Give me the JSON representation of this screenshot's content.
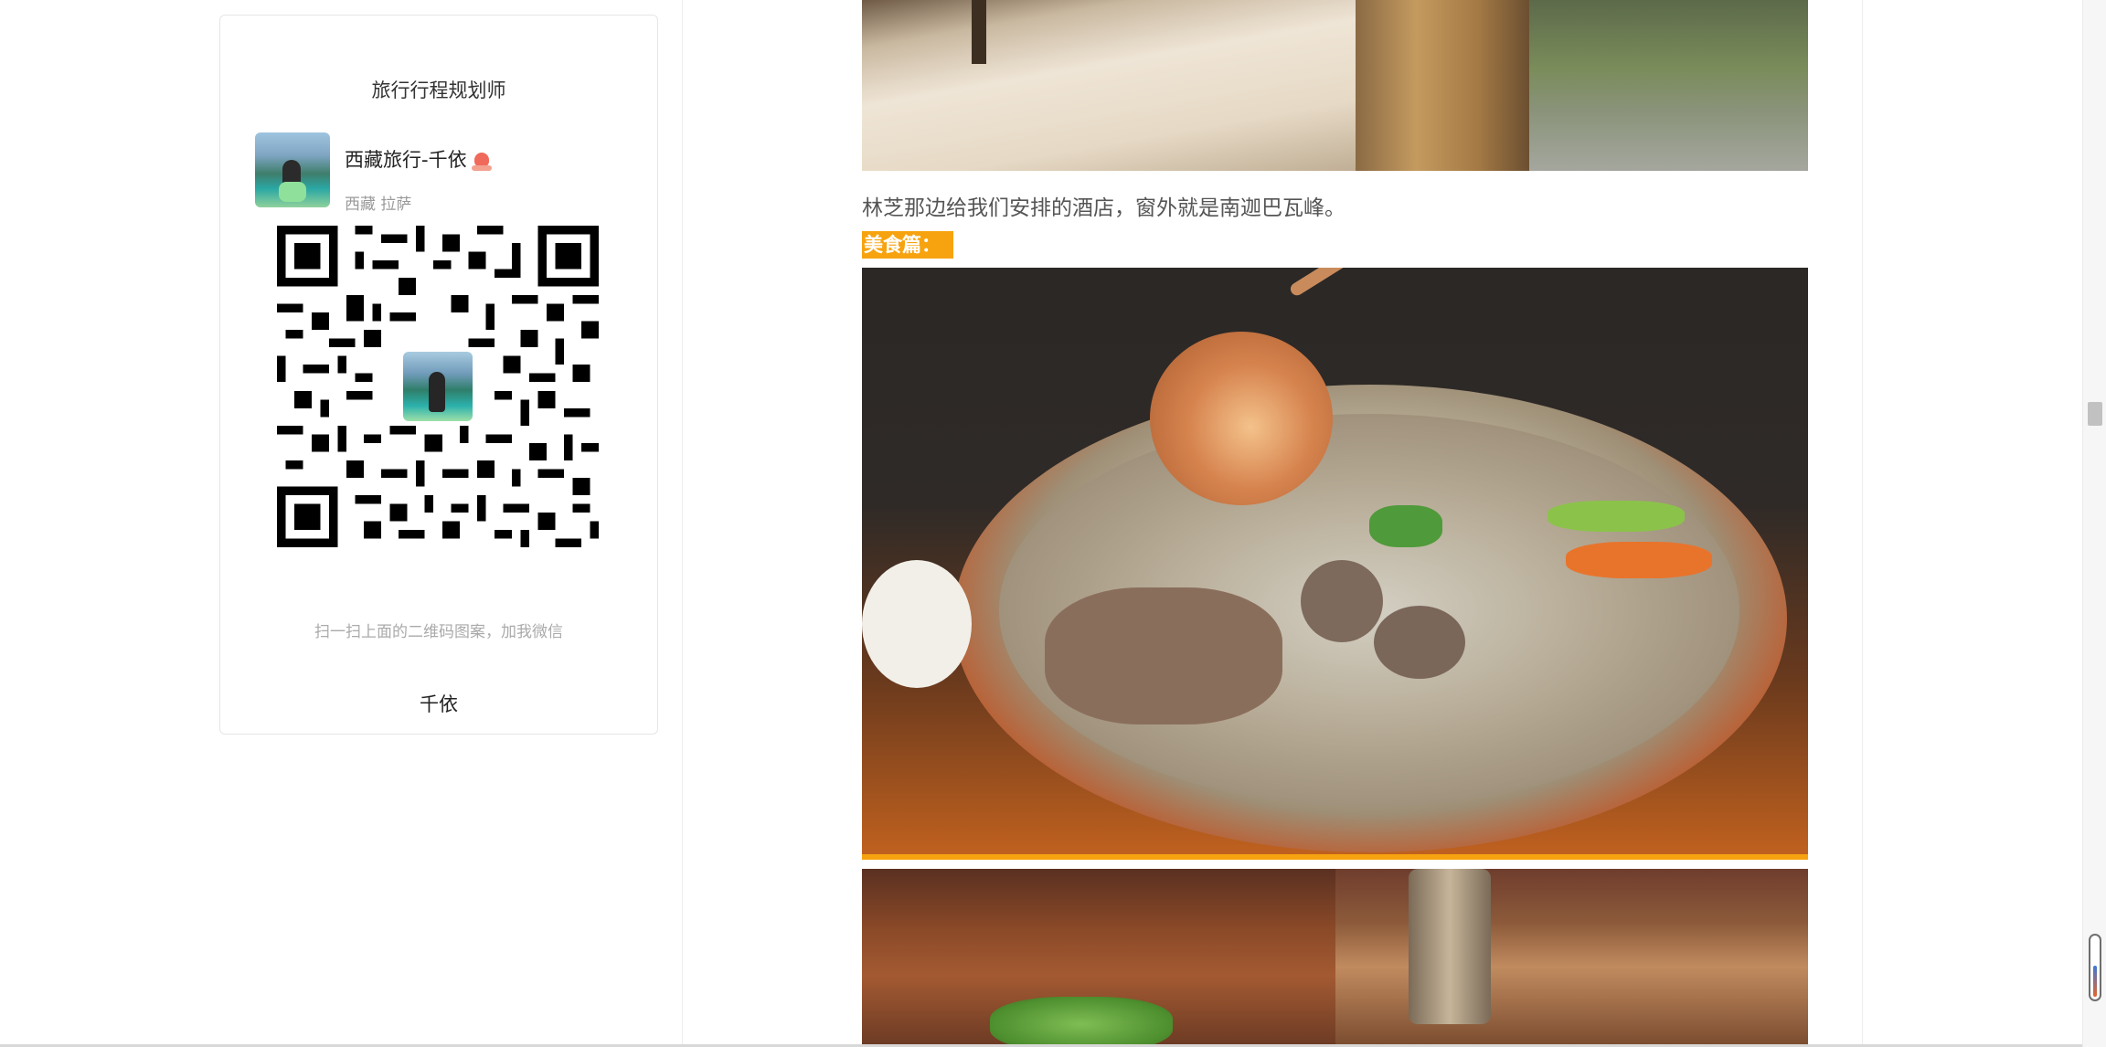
{
  "sidebar": {
    "title": "旅行行程规划师",
    "profile": {
      "name": "西藏旅行-千依",
      "location": "西藏 拉萨"
    },
    "qr_hint": "扫一扫上面的二维码图案，加我微信",
    "footer_name": "千依"
  },
  "article": {
    "hotel_caption": "林芝那边给我们安排的酒店，窗外就是南迦巴瓦峰。",
    "section_label": "美食篇："
  },
  "colors": {
    "accent": "#f7a30f",
    "caption_text": "#555555",
    "hint_text": "#aaaaaa"
  },
  "icons": {
    "profile_badge": "person-badge-icon",
    "scroll_indicator": "scroll-position-icon"
  }
}
